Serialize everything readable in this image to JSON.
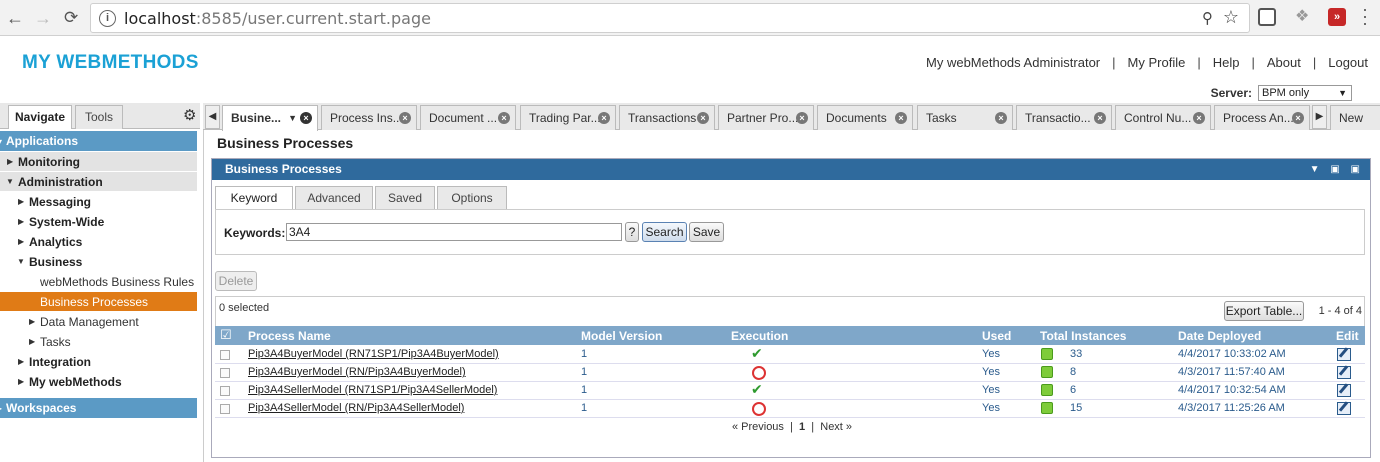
{
  "browser": {
    "url_host": "localhost",
    "url_rest": ":8585/user.current.start.page",
    "info_icon": "info-icon",
    "back": "←",
    "forward": "→",
    "reload": "C"
  },
  "header": {
    "app_title": "MY WEBMETHODS",
    "links": [
      "My webMethods Administrator",
      "My Profile",
      "Help",
      "About",
      "Logout"
    ],
    "server_label": "Server:",
    "server_value": "BPM only"
  },
  "sidebar": {
    "tabs": [
      "Navigate",
      "Tools"
    ],
    "items": [
      {
        "label": "Applications",
        "kind": "section"
      },
      {
        "label": "Monitoring",
        "kind": "group"
      },
      {
        "label": "Administration",
        "kind": "group"
      },
      {
        "label": "Messaging",
        "kind": "sub"
      },
      {
        "label": "System-Wide",
        "kind": "sub"
      },
      {
        "label": "Analytics",
        "kind": "sub"
      },
      {
        "label": "Business",
        "kind": "sub"
      },
      {
        "label": "webMethods Business Rules",
        "kind": "leaf"
      },
      {
        "label": "Business Processes",
        "kind": "selected"
      },
      {
        "label": "Data Management",
        "kind": "leaf"
      },
      {
        "label": "Tasks",
        "kind": "leaf"
      },
      {
        "label": "Integration",
        "kind": "sub"
      },
      {
        "label": "My webMethods",
        "kind": "sub"
      },
      {
        "label": "Workspaces",
        "kind": "section"
      }
    ]
  },
  "tabs": [
    "Busine...",
    "Process Ins...",
    "Document ...",
    "Trading Par...",
    "Transactions",
    "Partner Pro...",
    "Documents",
    "Tasks",
    "Transactio...",
    "Control Nu...",
    "Process An...",
    "New"
  ],
  "page": {
    "title": "Business Processes",
    "panel_title": "Business Processes",
    "subtabs": [
      "Keyword",
      "Advanced",
      "Saved",
      "Options"
    ],
    "keywords_label": "Keywords:",
    "keywords_value": "3A4",
    "help_button": "?",
    "search_button": "Search",
    "save_button": "Save",
    "delete_button": "Delete",
    "selected_text": "0 selected",
    "export_button": "Export Table...",
    "range_text": "1 - 4 of 4",
    "columns": [
      "Process Name",
      "Model Version",
      "Execution",
      "Used",
      "Total Instances",
      "Date Deployed",
      "Edit"
    ],
    "rows": [
      {
        "name": "Pip3A4BuyerModel (RN71SP1/Pip3A4BuyerModel)",
        "version": "1",
        "execution": "ok",
        "used": "Yes",
        "instances": "33",
        "deployed": "4/4/2017 10:33:02 AM"
      },
      {
        "name": "Pip3A4BuyerModel (RN/Pip3A4BuyerModel)",
        "version": "1",
        "execution": "fail",
        "used": "Yes",
        "instances": "8",
        "deployed": "4/3/2017 11:57:40 AM"
      },
      {
        "name": "Pip3A4SellerModel (RN71SP1/Pip3A4SellerModel)",
        "version": "1",
        "execution": "ok",
        "used": "Yes",
        "instances": "6",
        "deployed": "4/4/2017 10:32:54 AM"
      },
      {
        "name": "Pip3A4SellerModel (RN/Pip3A4SellerModel)",
        "version": "1",
        "execution": "fail",
        "used": "Yes",
        "instances": "15",
        "deployed": "4/3/2017 11:25:26 AM"
      }
    ],
    "pager": {
      "prev": "« Previous",
      "current": "1",
      "next": "Next »"
    }
  }
}
